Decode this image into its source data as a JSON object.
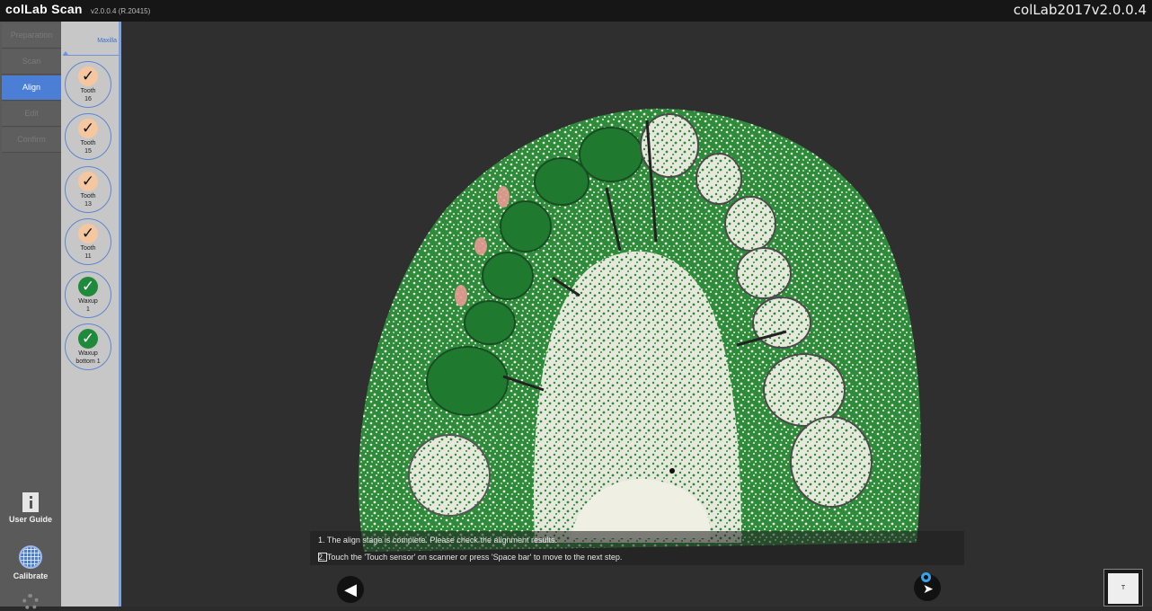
{
  "titlebar": {
    "brand": "colLab Scan",
    "version": "v2.0.0.4 (R.20415)",
    "right_title": "colLab2017v2.0.0.4"
  },
  "steps": [
    {
      "label": "Preparation",
      "active": false
    },
    {
      "label": "Scan",
      "active": false
    },
    {
      "label": "Align",
      "active": true
    },
    {
      "label": "Edit",
      "active": false
    },
    {
      "label": "Confirm",
      "active": false
    }
  ],
  "utilities": {
    "user_guide": "User Guide",
    "calibrate": "Calibrate"
  },
  "panel": {
    "tab": "Maxilla",
    "items": [
      {
        "line1": "Tooth",
        "line2": "16",
        "status": "peach"
      },
      {
        "line1": "Tooth",
        "line2": "15",
        "status": "peach"
      },
      {
        "line1": "Tooth",
        "line2": "13",
        "status": "peach"
      },
      {
        "line1": "Tooth",
        "line2": "11",
        "status": "peach"
      },
      {
        "line1": "Waxup",
        "line2": "1",
        "status": "green"
      },
      {
        "line1": "Waxup",
        "line2": "bottom 1",
        "status": "green"
      }
    ]
  },
  "messages": {
    "line1": "1. The align stage is complete. Please check the alignment results.",
    "line2": "2. Touch the 'Touch sensor' on scanner or press 'Space bar' to move to the next step."
  },
  "view_button": "T",
  "colors": {
    "accent": "#4b7fd6",
    "model_green": "#2e8b3a",
    "model_white": "#eceee4",
    "peach": "#f5c7a0"
  }
}
